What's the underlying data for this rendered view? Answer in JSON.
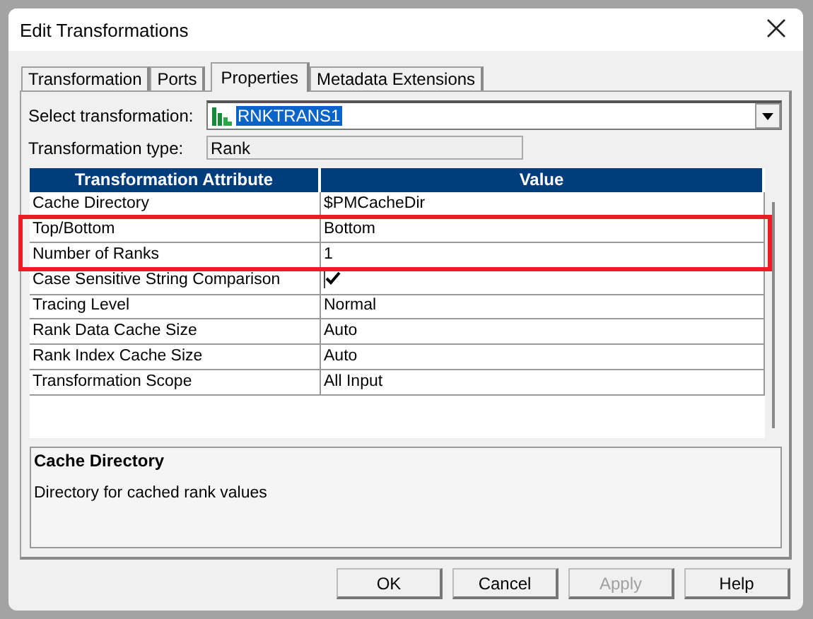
{
  "window": {
    "title": "Edit Transformations"
  },
  "tabs": [
    {
      "label": "Transformation",
      "selected": false
    },
    {
      "label": "Ports",
      "selected": false
    },
    {
      "label": "Properties",
      "selected": true
    },
    {
      "label": "Metadata Extensions",
      "selected": false
    }
  ],
  "select_transformation": {
    "label": "Select transformation:",
    "value": "RNKTRANS1"
  },
  "transformation_type": {
    "label": "Transformation type:",
    "value": "Rank"
  },
  "table": {
    "columns": [
      "Transformation Attribute",
      "Value"
    ],
    "rows": [
      {
        "attribute": "Cache Directory",
        "kind": "text",
        "value": "$PMCacheDir",
        "highlighted": false
      },
      {
        "attribute": "Top/Bottom",
        "kind": "text",
        "value": "Bottom",
        "highlighted": true
      },
      {
        "attribute": "Number of Ranks",
        "kind": "text",
        "value": "1",
        "highlighted": true
      },
      {
        "attribute": "Case Sensitive String Comparison",
        "kind": "checkbox",
        "checked": true,
        "highlighted": false
      },
      {
        "attribute": "Tracing Level",
        "kind": "text",
        "value": "Normal",
        "highlighted": false
      },
      {
        "attribute": "Rank Data Cache Size",
        "kind": "text",
        "value": "Auto",
        "highlighted": false
      },
      {
        "attribute": "Rank Index Cache Size",
        "kind": "text",
        "value": "Auto",
        "highlighted": false
      },
      {
        "attribute": "Transformation Scope",
        "kind": "text",
        "value": "All Input",
        "highlighted": false
      }
    ]
  },
  "description": {
    "title": "Cache Directory",
    "text": "Directory for cached rank values"
  },
  "buttons": [
    {
      "label": "OK",
      "disabled": false
    },
    {
      "label": "Cancel",
      "disabled": false
    },
    {
      "label": "Apply",
      "disabled": true
    },
    {
      "label": "Help",
      "disabled": false
    }
  ]
}
